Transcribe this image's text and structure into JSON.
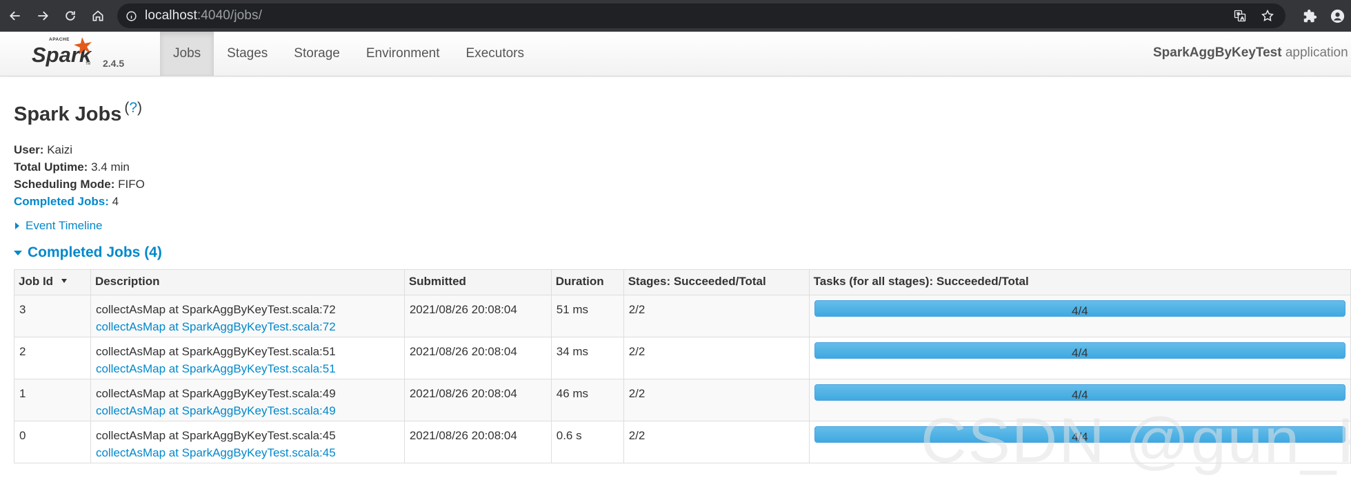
{
  "browser": {
    "url_host": "localhost",
    "url_rest": ":4040/jobs/"
  },
  "navbar": {
    "version": "2.4.5",
    "tabs": [
      {
        "label": "Jobs",
        "active": true
      },
      {
        "label": "Stages"
      },
      {
        "label": "Storage"
      },
      {
        "label": "Environment"
      },
      {
        "label": "Executors"
      }
    ],
    "app_name": "SparkAggByKeyTest",
    "app_suffix": "application UI"
  },
  "page": {
    "title": "Spark Jobs",
    "help_link": "?",
    "summary": {
      "user_label": "User:",
      "user_value": "Kaizi",
      "uptime_label": "Total Uptime:",
      "uptime_value": "3.4 min",
      "scheduling_label": "Scheduling Mode:",
      "scheduling_value": "FIFO",
      "completed_label": "Completed Jobs:",
      "completed_value": "4"
    },
    "event_timeline": "Event Timeline",
    "completed_section": "Completed Jobs (4)"
  },
  "table": {
    "headers": {
      "job_id": "Job Id",
      "description": "Description",
      "submitted": "Submitted",
      "duration": "Duration",
      "stages": "Stages: Succeeded/Total",
      "tasks": "Tasks (for all stages): Succeeded/Total"
    },
    "rows": [
      {
        "id": "3",
        "desc": "collectAsMap at SparkAggByKeyTest.scala:72",
        "link": "collectAsMap at SparkAggByKeyTest.scala:72",
        "submitted": "2021/08/26 20:08:04",
        "duration": "51 ms",
        "stages": "2/2",
        "tasks": "4/4",
        "progress": 1.0
      },
      {
        "id": "2",
        "desc": "collectAsMap at SparkAggByKeyTest.scala:51",
        "link": "collectAsMap at SparkAggByKeyTest.scala:51",
        "submitted": "2021/08/26 20:08:04",
        "duration": "34 ms",
        "stages": "2/2",
        "tasks": "4/4",
        "progress": 1.0
      },
      {
        "id": "1",
        "desc": "collectAsMap at SparkAggByKeyTest.scala:49",
        "link": "collectAsMap at SparkAggByKeyTest.scala:49",
        "submitted": "2021/08/26 20:08:04",
        "duration": "46 ms",
        "stages": "2/2",
        "tasks": "4/4",
        "progress": 1.0
      },
      {
        "id": "0",
        "desc": "collectAsMap at SparkAggByKeyTest.scala:45",
        "link": "collectAsMap at SparkAggByKeyTest.scala:45",
        "submitted": "2021/08/26 20:08:04",
        "duration": "0.6 s",
        "stages": "2/2",
        "tasks": "4/4",
        "progress": 1.0
      }
    ]
  },
  "watermark": "CSDN @gun_K",
  "colors": {
    "link": "#0088cc",
    "progress": "#3fa9e1",
    "chrome_bg": "#35363a",
    "omnibox_bg": "#202124"
  },
  "icons": [
    "back-icon",
    "forward-icon",
    "reload-icon",
    "home-icon",
    "site-info-icon",
    "translate-icon",
    "bookmark-star-icon",
    "extensions-icon",
    "profile-icon",
    "spark-logo"
  ]
}
